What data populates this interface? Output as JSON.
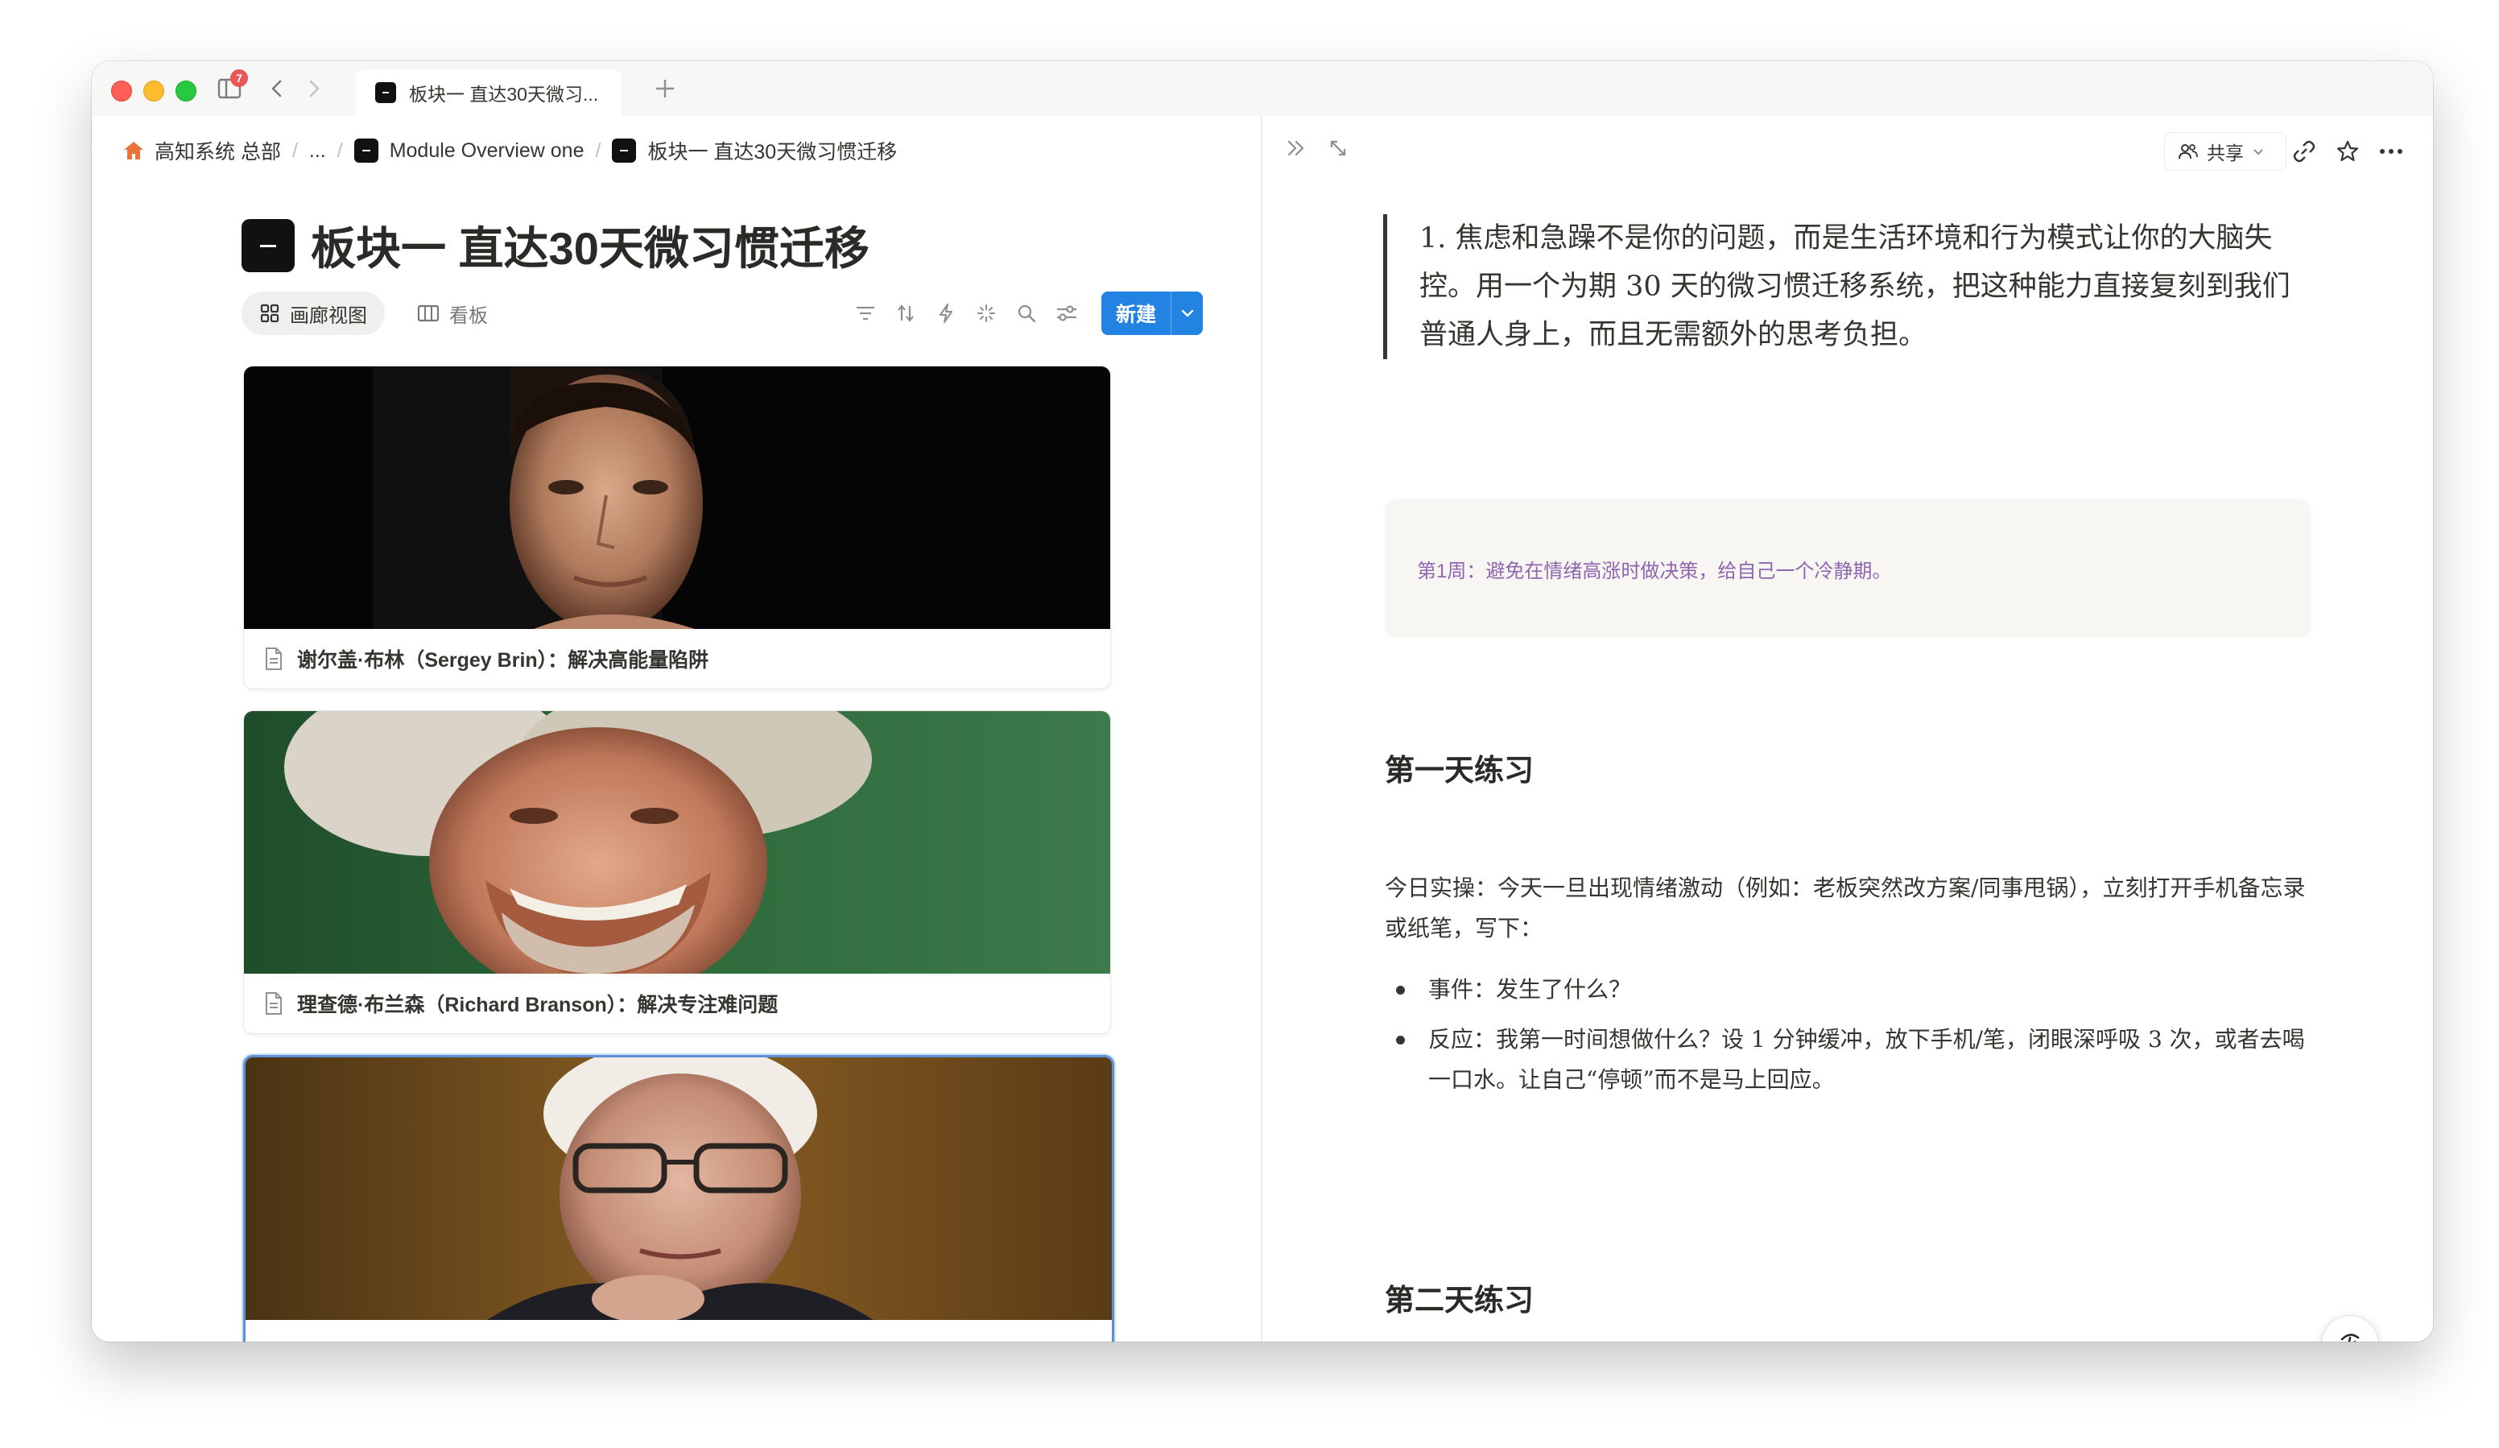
{
  "tab": {
    "title": "板块一 直达30天微习..."
  },
  "titlebar": {
    "notification_count": "7"
  },
  "breadcrumb": {
    "items": [
      "高知系统 总部",
      "...",
      "Module Overview one",
      "板块一 直达30天微习惯迁移"
    ]
  },
  "page": {
    "title": "板块一 直达30天微习惯迁移"
  },
  "views": {
    "gallery_label": "画廊视图",
    "board_label": "看板",
    "new_label": "新建"
  },
  "cards": [
    {
      "caption": "谢尔盖·布林（Sergey Brin）：解决高能量陷阱"
    },
    {
      "caption": "理查德·布兰森（Richard Branson）：解决专注难问题"
    },
    {
      "caption": ""
    }
  ],
  "detail": {
    "share_label": "共享",
    "quote": "1. 焦虑和急躁不是你的问题，而是生活环境和行为模式让你的大脑失控。用一个为期 30 天的微习惯迁移系统，把这种能力直接复刻到我们普通人身上，而且无需额外的思考负担。",
    "callout": "第1周：避免在情绪高涨时做决策，给自己一个冷静期。",
    "day1_heading": "第一天练习",
    "day1_intro": "今日实操：今天一旦出现情绪激动（例如：老板突然改方案/同事甩锅），立刻打开手机备忘录或纸笔，写下：",
    "day1_bullets": [
      "事件：发生了什么？",
      "反应：我第一时间想做什么？设 1 分钟缓冲，放下手机/笔，闭眼深呼吸 3 次，或者去喝一口水。让自己“停顿”而不是马上回应。"
    ],
    "day2_heading": "第二天练习"
  },
  "colors": {
    "accent": "#2383e2",
    "callout_text": "#9065b0",
    "close": "#fe5f57",
    "minimize": "#febc2e",
    "zoom": "#28c840"
  }
}
